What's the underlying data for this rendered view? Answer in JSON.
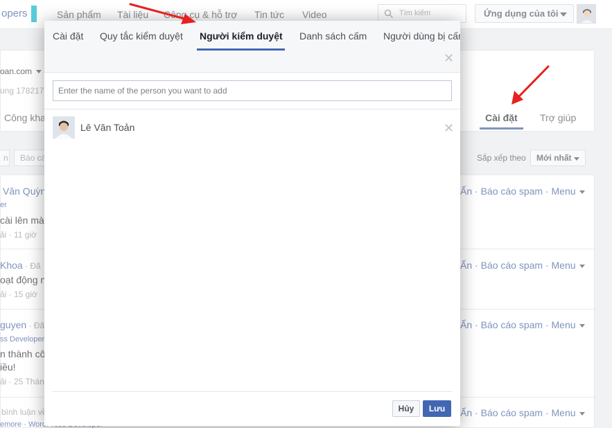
{
  "topnav": {
    "brand": "opers",
    "links": [
      "Sản phẩm",
      "Tài liệu",
      "Công cụ & hỗ trợ",
      "Tin tức",
      "Video"
    ],
    "search_placeholder": "Tìm kiếm",
    "apps_button": "Ứng dụng của tôi"
  },
  "background": {
    "domain_label": "oan.com",
    "id_text": "ung 178217",
    "left_tab": "Công kha",
    "right_tabs": [
      "Cài đặt",
      "Trợ giúp"
    ],
    "chips": [
      "n",
      "Báo cá"
    ],
    "sort_label": "Sắp xếp theo",
    "sort_value": "Mới nhất",
    "row_actions": "Ẩn · Báo cáo spam · Menu",
    "rows": [
      {
        "name": "Văn Quỳn",
        "line2": "er",
        "text": "cài lên mà l",
        "meta": "ải · 11 giờ"
      },
      {
        "name": "Khoa",
        "suffix": " · Đã",
        "text": "oạt động n",
        "meta": "ải · 15 giờ"
      },
      {
        "name": "guyen",
        "suffix": " · Đã",
        "line2": "ss Developer",
        "text": "n thành cô",
        "text2": "iều!",
        "meta": "ải · 25 Tháng"
      },
      {
        "text": "bình luận về",
        "line2": "emore · WordPress Developer"
      }
    ]
  },
  "dialog": {
    "tabs": [
      "Cài đặt",
      "Quy tắc kiểm duyệt",
      "Người kiểm duyệt",
      "Danh sách cấm",
      "Người dùng bị cấm"
    ],
    "active_tab": "Người kiểm duyệt",
    "add_placeholder": "Enter the name of the person you want to add",
    "moderators": [
      {
        "name": "Lê Văn Toản"
      }
    ],
    "cancel_label": "Hủy",
    "save_label": "Lưu"
  },
  "colors": {
    "accent": "#4267b2",
    "link": "#3b5998",
    "brand_bar": "#00b1c8",
    "annotation_arrow": "#e8201f"
  }
}
